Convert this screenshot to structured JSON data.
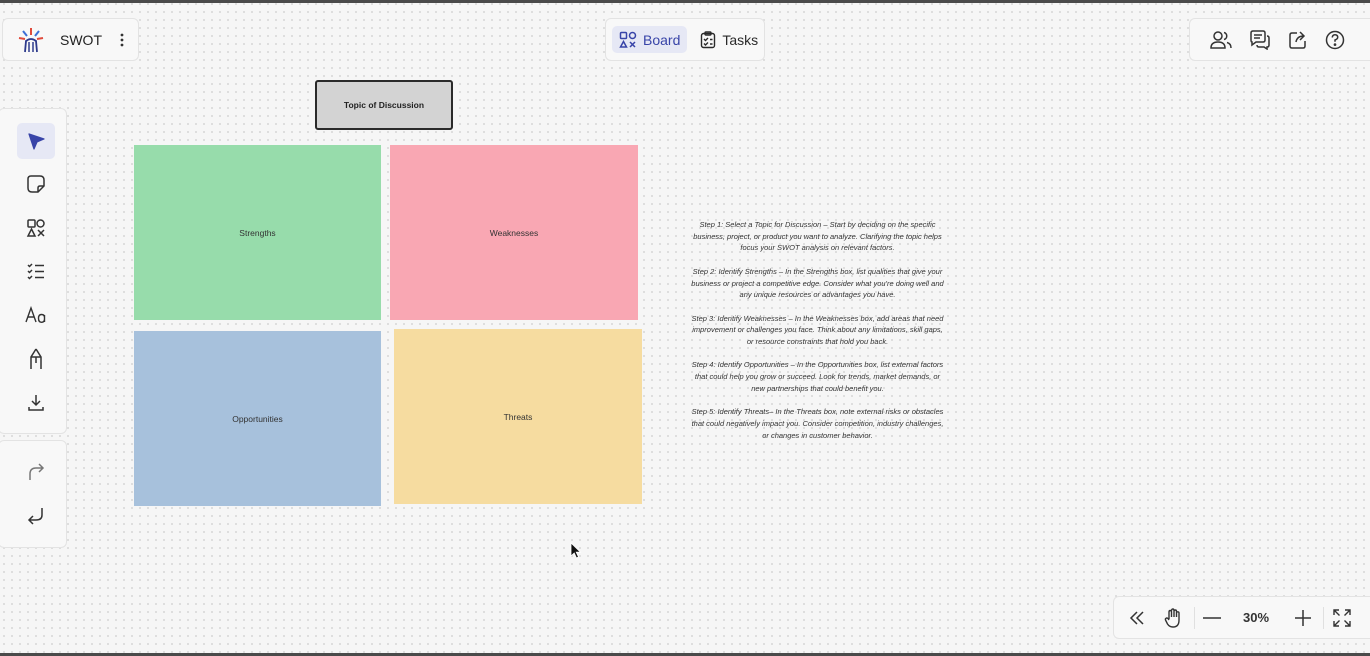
{
  "header": {
    "doc_title": "SWOT",
    "tabs": [
      {
        "label": "Board",
        "active": true
      },
      {
        "label": "Tasks",
        "active": false
      }
    ]
  },
  "board": {
    "topic_label": "Topic of Discussion",
    "quadrants": {
      "strengths": "Strengths",
      "weaknesses": "Weaknesses",
      "opportunities": "Opportunities",
      "threats": "Threats"
    },
    "steps": [
      "Step 1: Select a Topic for Discussion – Start by deciding on the specific business, project, or product you want to analyze. Clarifying the topic helps focus your SWOT analysis on relevant factors.",
      "Step 2: Identify Strengths – In the Strengths box, list qualities that give your business or project a competitive edge. Consider what you're doing well and any unique resources or advantages you have.",
      "Step 3: Identify Weaknesses – In the Weaknesses box, add areas that need improvement or challenges you face. Think about any limitations, skill gaps, or resource constraints that hold you back.",
      "Step 4: Identify Opportunities – In the Opportunities box, list external factors that could help you grow or succeed. Look for trends, market demands, or new partnerships that could benefit you.",
      "Step 5: Identify Threats– In the Threats box, note external risks or obstacles that could negatively impact you. Consider competition, industry challenges, or changes in customer behavior."
    ]
  },
  "zoom": {
    "level": "30%"
  },
  "colors": {
    "accent": "#3844a8",
    "strengths": "#97dcab",
    "weaknesses": "#f9a7b3",
    "opportunities": "#a7c1dc",
    "threats": "#f6dca0",
    "topic": "#d3d3d3"
  },
  "icons": {
    "toolbar": [
      "select-pointer-icon",
      "sticky-note-icon",
      "shapes-icon",
      "checklist-icon",
      "text-icon",
      "pen-icon",
      "download-icon"
    ],
    "history": [
      "redo-icon",
      "undo-icon"
    ],
    "header_right": [
      "users-icon",
      "comments-icon",
      "share-icon",
      "help-icon"
    ],
    "zoombar": [
      "collapse-icon",
      "hand-icon",
      "zoom-out-icon",
      "zoom-in-icon",
      "fit-screen-icon"
    ]
  }
}
